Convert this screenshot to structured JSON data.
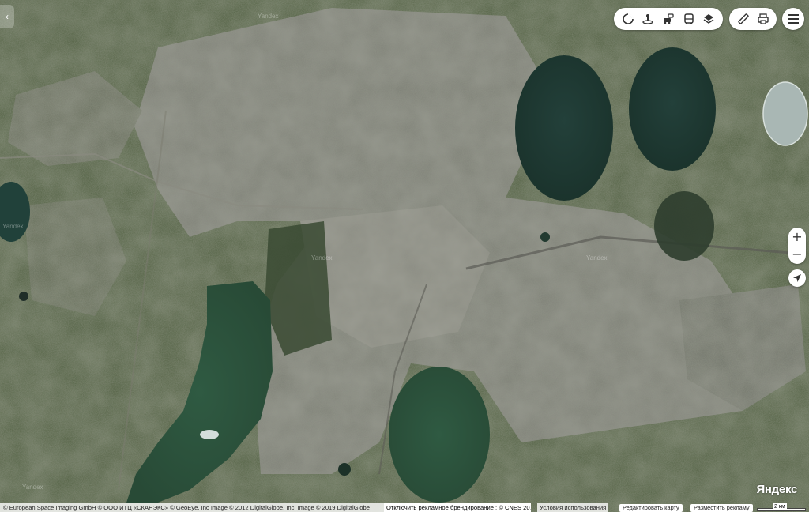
{
  "map": {
    "type": "satellite",
    "watermark": "Yandex",
    "logo": "Яндекс",
    "attribution": "© European Space Imaging GmbH © ООО ИТЦ «СКАНЭКС» © GeoEye, Inc Image © 2012 DigitalGlobe, Inc. Image © 2019 DigitalGlobe",
    "ad_branding_link": "Отключить рекламное брендирование : © CNES 20…",
    "terms_link": "Условия использования",
    "edit_map_button": "Редактировать карту",
    "place_ad_button": "Разместить рекламу",
    "scale_label": "2 км"
  },
  "toolbar": {
    "layers_group": [
      "traffic-icon",
      "panorama-icon",
      "routes-icon",
      "transport-icon",
      "layers-icon"
    ],
    "tools_group": [
      "ruler-icon",
      "print-icon"
    ],
    "menu": "menu-icon"
  },
  "controls": {
    "zoom_in": "+",
    "zoom_out": "−",
    "geolocation": "geolocation-icon",
    "panel_toggle": "‹"
  },
  "colors": {
    "water": "#1f3b33",
    "vegetation": "#4d5e3a",
    "urban": "#7d7f76",
    "drained_lake": "#aab8b6",
    "control_bg": "#ffffff"
  }
}
